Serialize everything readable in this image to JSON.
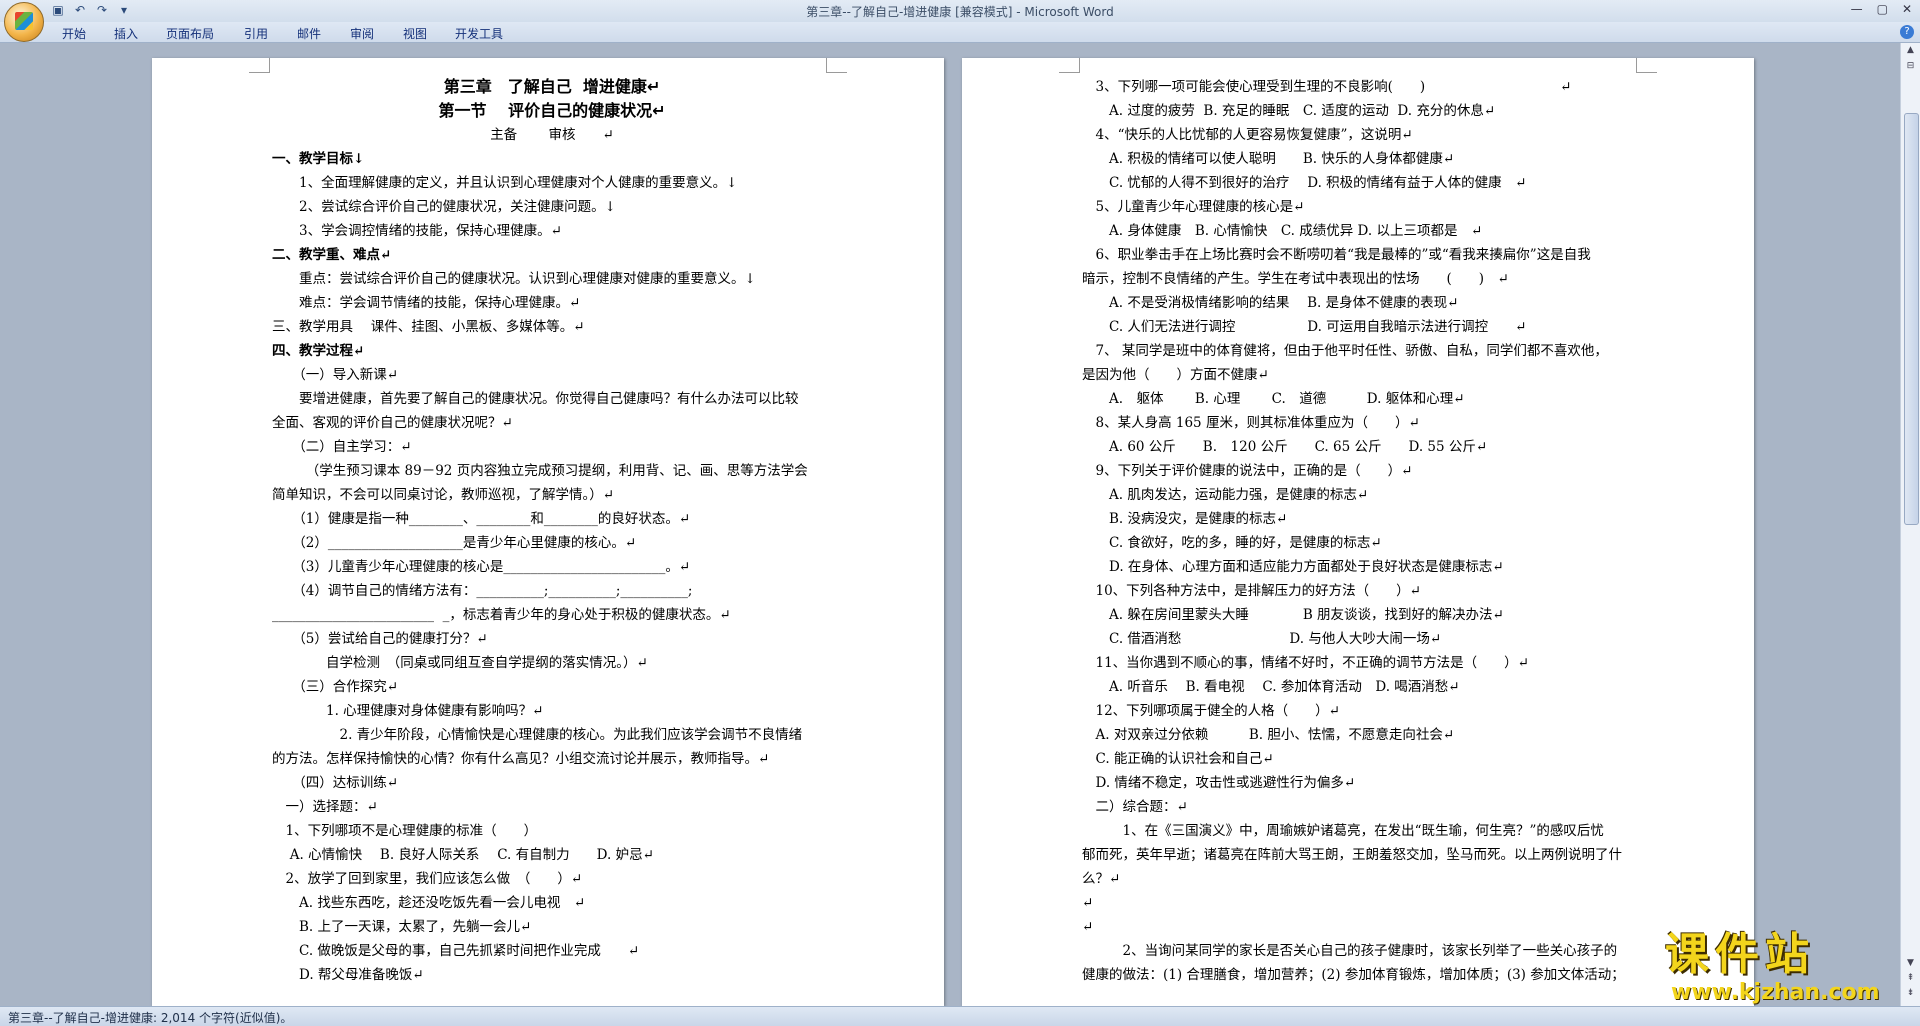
{
  "window": {
    "title": "第三章--了解自己-增进健康 [兼容模式] - Microsoft Word"
  },
  "ribbon_tabs": [
    "开始",
    "插入",
    "页面布局",
    "引用",
    "邮件",
    "审阅",
    "视图",
    "开发工具"
  ],
  "status": {
    "text": "第三章--了解自己-增进健康: 2,014 个字符(近似值)。"
  },
  "watermark": {
    "big": "课件站",
    "small": "www.kjzhan.com"
  },
  "doc": {
    "left": [
      {
        "t": "第三章　了解自己  增进健康↵",
        "c": "title"
      },
      {
        "t": "第一节　 评价自己的健康状况↵",
        "c": "title"
      },
      {
        "t": "主备　　 审核　　↵",
        "c": "center"
      },
      {
        "t": "一、教学目标↓",
        "c": "b"
      },
      {
        "t": "　　1、全面理解健康的定义，并且认识到心理健康对个人健康的重要意义。↓"
      },
      {
        "t": "　　2、尝试综合评价自己的健康状况，关注健康问题。↓"
      },
      {
        "t": "　　3、学会调控情绪的技能，保持心理健康。↵"
      },
      {
        "t": "二、教学重、难点↵",
        "c": "b"
      },
      {
        "t": "　　重点：尝试综合评价自己的健康状况。认识到心理健康对健康的重要意义。↓"
      },
      {
        "t": "　　难点：学会调节情绪的技能，保持心理健康。↵"
      },
      {
        "t": "三、教学用具　 课件、挂图、小黑板、多媒体等。↵"
      },
      {
        "t": "四、教学过程↵",
        "c": "b"
      },
      {
        "t": "　　（一）导入新课↵"
      },
      {
        "t": "　　要增进健康，首先要了解自己的健康状况。你觉得自己健康吗？有什么办法可以比较"
      },
      {
        "t": "全面、客观的评价自己的健康状况呢？↵"
      },
      {
        "t": "　　（二）自主学习：↵"
      },
      {
        "t": "　　　（学生预习课本 89－92 页内容独立完成预习提纲，利用背、记、画、思等方法学会"
      },
      {
        "t": "简单知识，不会可以同桌讨论，教师巡视，了解学情。）↵"
      },
      {
        "t": "　　（1）健康是指一种________、________和________的良好状态。↵"
      },
      {
        "t": "　　（2）____________________是青少年心里健康的核心。↵"
      },
      {
        "t": "　　（3）儿童青少年心理健康的核心是________________________。↵"
      },
      {
        "t": "　　（4）调节自己的情绪方法有：__________;__________;__________;"
      },
      {
        "t": "________________________  _，标志着青少年的身心处于积极的健康状态。↵"
      },
      {
        "t": "　　（5）尝试给自己的健康打分？↵"
      },
      {
        "t": "　　　　自学检测　（同桌或同组互查自学提纲的落实情况。）↵"
      },
      {
        "t": "　　（三）合作探究↵"
      },
      {
        "t": "　　　　1. 心理健康对身体健康有影响吗？↵"
      },
      {
        "t": "　　　　　2. 青少年阶段，心情愉快是心理健康的核心。为此我们应该学会调节不良情绪"
      },
      {
        "t": "的方法。怎样保持愉快的心情？你有什么高见？小组交流讨论并展示，教师指导。↵"
      },
      {
        "t": "　　（四）达标训练↵"
      },
      {
        "t": "　一）选择题：↵"
      },
      {
        "t": "　1、下列哪项不是心理健康的标准（　　）"
      },
      {
        "t": "　 A. 心情愉快　 B. 良好人际关系　 C. 有自制力　　D. 妒忌↵"
      },
      {
        "t": "　2、放学了回到家里，我们应该怎么做　（　　）↵"
      },
      {
        "t": "　　A. 找些东西吃，趁还没吃饭先看一会儿电视　↵"
      },
      {
        "t": "　　B. 上了一天课，太累了，先躺一会儿↵"
      },
      {
        "t": "　　C. 做晚饭是父母的事，自己先抓紧时间把作业完成　　↵"
      },
      {
        "t": "　　D. 帮父母准备晚饭↵"
      }
    ],
    "right": [
      {
        "t": "　3、下列哪一项可能会使心理受到生理的不良影响(　　)　　　　　　　　　　↵"
      },
      {
        "t": "　　A. 过度的疲劳  B. 充足的睡眠　C. 适度的运动  D. 充分的休息↵"
      },
      {
        "t": "　4、“快乐的人比忧郁的人更容易恢复健康”，这说明↵"
      },
      {
        "t": "　　A. 积极的情绪可以使人聪明　　B. 快乐的人身体都健康↵"
      },
      {
        "t": "　　C. 忧郁的人得不到很好的治疗　 D. 积极的情绪有益于人体的健康　↵"
      },
      {
        "t": "　5、儿童青少年心理健康的核心是↵"
      },
      {
        "t": "　　A. 身体健康　B. 心情愉快　C. 成绩优异 D. 以上三项都是　↵"
      },
      {
        "t": "　6、职业拳击手在上场比赛时会不断唠叨着“我是最棒的”或“看我来揍扁你”这是自我"
      },
      {
        "t": "暗示，控制不良情绪的产生。学生在考试中表现出的怯场　　(　　)　↵"
      },
      {
        "t": "　　A. 不是受消极情绪影响的结果　 B. 是身体不健康的表现↵"
      },
      {
        "t": "　　C. 人们无法进行调控　　　　　 D. 可运用自我暗示法进行调控　　↵"
      },
      {
        "t": "　7、 某同学是班中的体育健将，但由于他平时任性、骄傲、自私，同学们都不喜欢他，"
      },
      {
        "t": "是因为他（　　）方面不健康↵"
      },
      {
        "t": "　　A.　躯体　　 B. 心理　　 C.　道德　　　D. 躯体和心理↵"
      },
      {
        "t": "　8、某人身高 165 厘米，则其标准体重应为（　　）↵"
      },
      {
        "t": "　　A. 60 公斤　　B.　120 公斤　　C. 65 公斤　　D. 55 公斤↵"
      },
      {
        "t": "　9、下列关于评价健康的说法中，正确的是（　　）↵"
      },
      {
        "t": "　　A. 肌肉发达，运动能力强，是健康的标志↵"
      },
      {
        "t": "　　B. 没病没灾，是健康的标志↵"
      },
      {
        "t": "　　C. 食欲好，吃的多，睡的好，是健康的标志↵"
      },
      {
        "t": "　　D. 在身体、心理方面和适应能力方面都处于良好状态是健康标志↵"
      },
      {
        "t": "　10、下列各种方法中，是排解压力的好方法（　　）↵"
      },
      {
        "t": "　　A. 躲在房间里蒙头大睡　　　　B 朋友谈谈，找到好的解决办法↵"
      },
      {
        "t": "　　C. 借酒消愁　　　　　　　　D. 与他人大吵大闹一场↵"
      },
      {
        "t": "　11、当你遇到不顺心的事，情绪不好时，不正确的调节方法是（　　）↵"
      },
      {
        "t": "　　A. 听音乐　 B. 看电视　 C. 参加体育活动　D. 喝酒消愁↵"
      },
      {
        "t": "　12、下列哪项属于健全的人格（　　）↵"
      },
      {
        "t": "　A. 对双亲过分依赖　　　B. 胆小、怯懦，不愿意走向社会↵"
      },
      {
        "t": "　C. 能正确的认识社会和自己↵"
      },
      {
        "t": "　D. 情绪不稳定，攻击性或逃避性行为偏多↵"
      },
      {
        "t": "　二）综合题：↵"
      },
      {
        "t": "　　　1、在《三国演义》中，周瑜嫉妒诸葛亮，在发出“既生瑜，何生亮？”的感叹后忧"
      },
      {
        "t": "郁而死，英年早逝；诸葛亮在阵前大骂王朗，王朗羞怒交加，坠马而死。以上两例说明了什"
      },
      {
        "t": "么？↵"
      },
      {
        "t": "↵"
      },
      {
        "t": "↵"
      },
      {
        "t": "　　　2、当询问某同学的家长是否关心自己的孩子健康时，该家长列举了一些关心孩子的"
      },
      {
        "t": "健康的做法：(1) 合理膳食，增加营养；(2) 参加体育锻炼，增加体质；(3) 参加文体活动；"
      }
    ]
  }
}
